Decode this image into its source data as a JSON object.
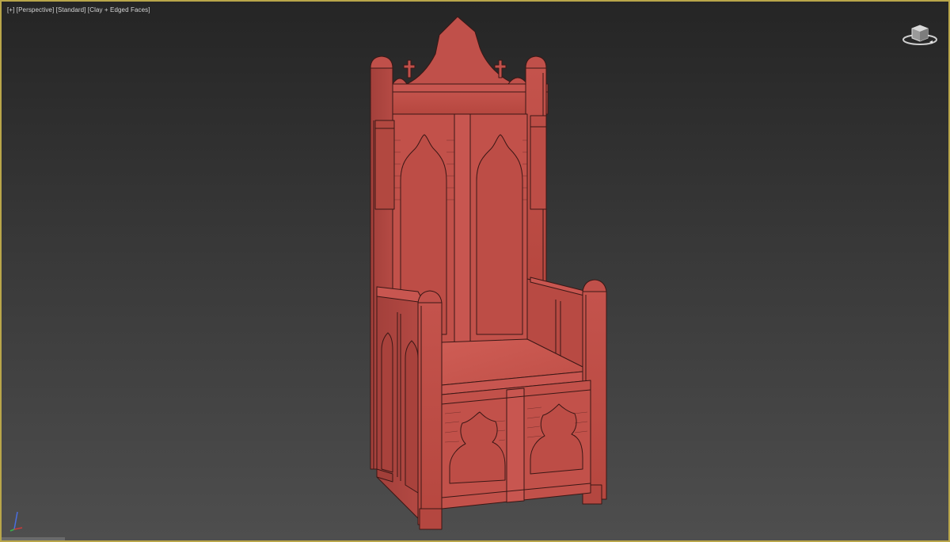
{
  "viewport": {
    "label_open": "[",
    "plus_label": "+",
    "sep": "] [",
    "view_label": "Perspective",
    "shading_label": "Standard",
    "display_label": "Clay + Edged Faces",
    "label_close": "]"
  },
  "colors": {
    "border_active": "#b9a64a",
    "model_clay": "#c0504a",
    "edge_lines": "#3a1715",
    "axis_z": "#4a6ee0"
  },
  "icons": {
    "viewcube": "viewcube-icon",
    "axis": "axis-tripod-icon"
  },
  "scene": {
    "object": "gothic-throne"
  }
}
